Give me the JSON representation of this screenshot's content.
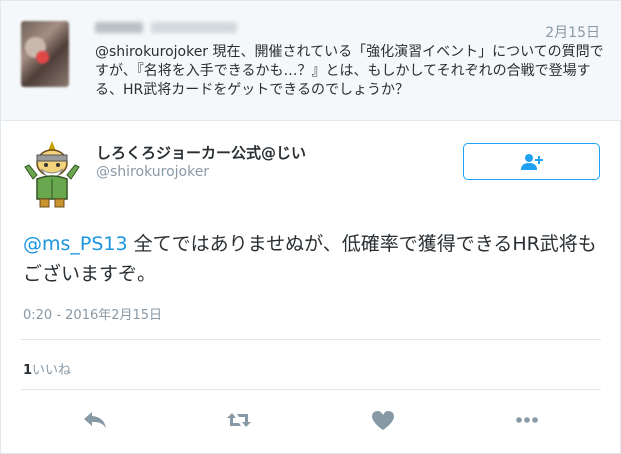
{
  "parent_tweet": {
    "date": "2月15日",
    "text": "@shirokurojoker 現在、開催されている「強化演習イベント」についての質問ですが、『名将を入手できるかも…？』とは、もしかしてそれぞれの合戦で登場する、HR武将カードをゲットできるのでしょうか？"
  },
  "main_tweet": {
    "display_name": "しろくろジョーカー公式@じい",
    "handle": "@shirokurojoker",
    "mention": "@ms_PS13",
    "body": " 全てではありませぬが、低確率で獲得できるHR武将もございますぞ。",
    "timestamp": "0:20 - 2016年2月15日",
    "like_count": "1",
    "like_label": "いいね"
  },
  "icons": {
    "follow": "add-user-icon",
    "reply": "reply-icon",
    "retweet": "retweet-icon",
    "like": "heart-icon",
    "more": "more-icon"
  },
  "colors": {
    "accent": "#1da1f2",
    "mention": "#1b95e0",
    "action_icon": "#8899a6"
  }
}
